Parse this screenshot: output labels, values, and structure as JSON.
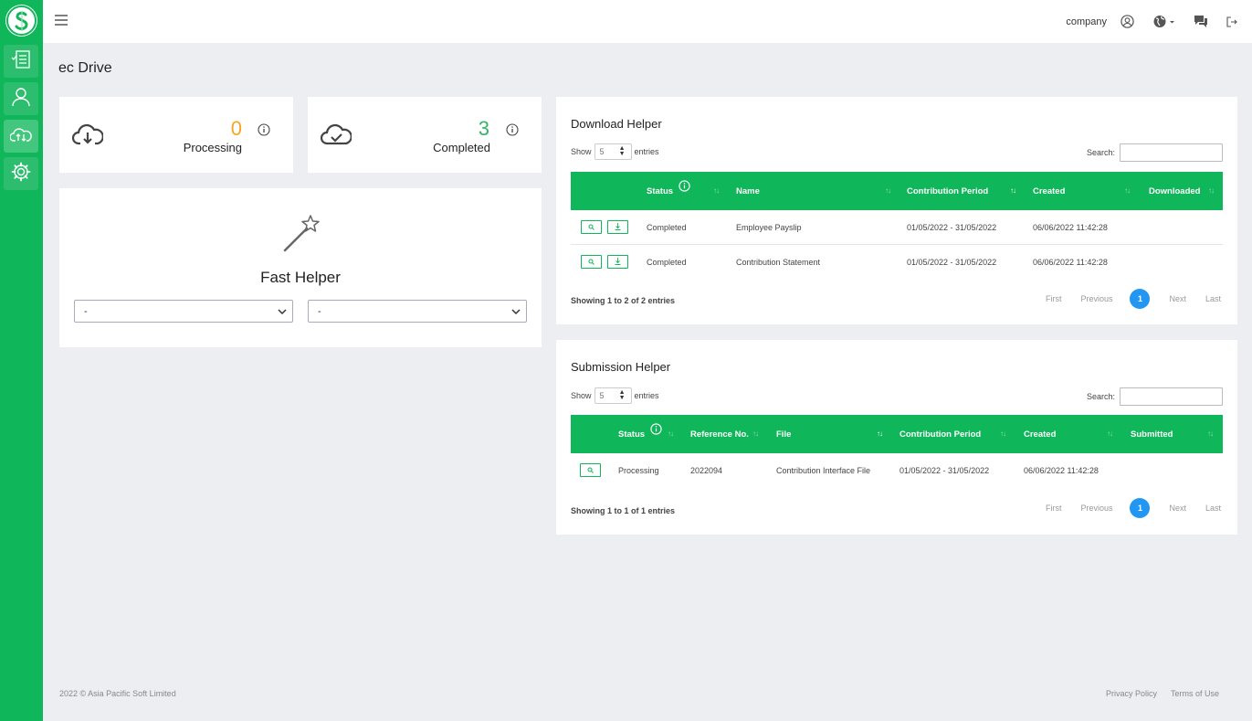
{
  "sidebar": {
    "logo_icon": "brand-s-logo",
    "items": [
      {
        "icon": "document-checklist-icon"
      },
      {
        "icon": "user-icon"
      },
      {
        "icon": "cloud-transfer-icon"
      },
      {
        "icon": "gear-icon"
      }
    ],
    "colors": {
      "accent": "#0fb65a"
    }
  },
  "topbar": {
    "menu_icon": "hamburger-icon",
    "company": "company",
    "icons": [
      "user-circle-icon",
      "globe-icon",
      "chat-icon",
      "logout-icon"
    ]
  },
  "page": {
    "title": "ec Drive"
  },
  "stats": [
    {
      "value": "0",
      "label": "Processing",
      "icon": "cloud-download-icon",
      "color": "#f5a623"
    },
    {
      "value": "3",
      "label": "Completed",
      "icon": "cloud-check-icon",
      "color": "#34b36a"
    }
  ],
  "fast_helper": {
    "title": "Fast Helper",
    "icon": "magic-wand-icon",
    "select1": "-",
    "select2": "-"
  },
  "download_helper": {
    "title": "Download Helper",
    "show_label": "Show",
    "show_value": "5",
    "entries_label": "entries",
    "search_label": "Search:",
    "columns": [
      "Status",
      "Name",
      "Contribution Period",
      "Created",
      "Downloaded"
    ],
    "rows": [
      {
        "status": "Completed",
        "name": "Employee Payslip",
        "period": "01/05/2022 - 31/05/2022",
        "created": "06/06/2022 11:42:28",
        "downloaded": ""
      },
      {
        "status": "Completed",
        "name": "Contribution Statement",
        "period": "01/05/2022 - 31/05/2022",
        "created": "06/06/2022 11:42:28",
        "downloaded": ""
      }
    ],
    "showing": "Showing 1 to 2 of 2 entries",
    "pager": {
      "first": "First",
      "previous": "Previous",
      "current": "1",
      "next": "Next",
      "last": "Last"
    }
  },
  "submission_helper": {
    "title": "Submission Helper",
    "show_label": "Show",
    "show_value": "5",
    "entries_label": "entries",
    "search_label": "Search:",
    "columns": [
      "Status",
      "Reference No.",
      "File",
      "Contribution Period",
      "Created",
      "Submitted"
    ],
    "rows": [
      {
        "status": "Processing",
        "reference": "2022094",
        "file": "Contribution Interface File",
        "period": "01/05/2022 - 31/05/2022",
        "created": "06/06/2022 11:42:28",
        "submitted": ""
      }
    ],
    "showing": "Showing 1 to 1 of 1 entries",
    "pager": {
      "first": "First",
      "previous": "Previous",
      "current": "1",
      "next": "Next",
      "last": "Last"
    }
  },
  "footer": {
    "copyright": "2022 © Asia Pacific Soft Limited",
    "privacy": "Privacy Policy",
    "terms": "Terms of Use"
  }
}
